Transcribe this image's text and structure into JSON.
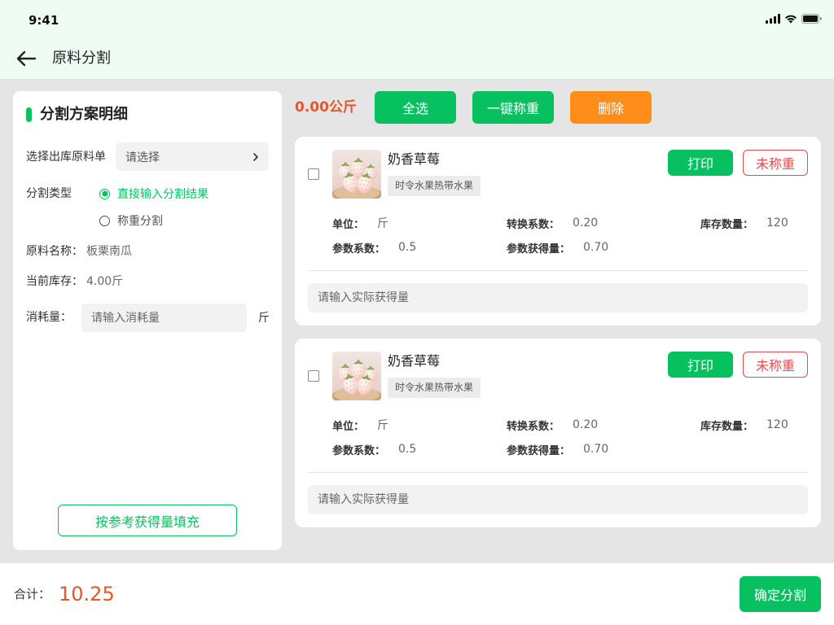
{
  "status_bar": {
    "time": "9:41",
    "icons": [
      "cellular-signal-icon",
      "wifi-icon",
      "battery-icon"
    ]
  },
  "header": {
    "title": "原料分割",
    "back_icon": "arrow-left-icon"
  },
  "left_panel": {
    "title": "分割方案明细",
    "order_select": {
      "label": "选择出库原料单",
      "placeholder": "请选择",
      "icon": "chevron-right-icon"
    },
    "split_type": {
      "label": "分割类型",
      "options": [
        {
          "label": "直接输入分割结果",
          "selected": true
        },
        {
          "label": "称重分割",
          "selected": false
        }
      ]
    },
    "material_name": {
      "label": "原料名称：",
      "value": "板栗南瓜"
    },
    "current_stock": {
      "label": "当前库存：",
      "value": "4.00斤"
    },
    "consumption": {
      "label": "消耗量：",
      "placeholder": "请输入消耗量",
      "value": "",
      "unit": "斤"
    },
    "fill_button": "按参考获得量填充"
  },
  "toolbar": {
    "total_weight": "0.00公斤",
    "select_all": "全选",
    "weigh_all": "一键称重",
    "delete": "删除"
  },
  "products": [
    {
      "name": "奶香草莓",
      "tag": "时令水果热带水果",
      "checked": false,
      "print_label": "打印",
      "status_label": "未称重",
      "fields": {
        "unit": {
          "label": "单位：",
          "value": "斤"
        },
        "conversion": {
          "label": "转换系数：",
          "value": "0.20"
        },
        "stock": {
          "label": "库存数量：",
          "value": "120"
        },
        "param_coef": {
          "label": "参数系数：",
          "value": "0.5"
        },
        "param_yield": {
          "label": "参数获得量：",
          "value": "0.70"
        }
      },
      "actual_input": {
        "placeholder": "请输入实际获得量",
        "value": ""
      }
    },
    {
      "name": "奶香草莓",
      "tag": "时令水果热带水果",
      "checked": false,
      "print_label": "打印",
      "status_label": "未称重",
      "fields": {
        "unit": {
          "label": "单位：",
          "value": "斤"
        },
        "conversion": {
          "label": "转换系数：",
          "value": "0.20"
        },
        "stock": {
          "label": "库存数量：",
          "value": "120"
        },
        "param_coef": {
          "label": "参数系数：",
          "value": "0.5"
        },
        "param_yield": {
          "label": "参数获得量：",
          "value": "0.70"
        }
      },
      "actual_input": {
        "placeholder": "请输入实际获得量",
        "value": ""
      }
    }
  ],
  "footer": {
    "total_label": "合计：",
    "total_value": "10.25",
    "confirm": "确定分割"
  },
  "colors": {
    "primary": "#07c160",
    "warning": "#ff8d1a",
    "danger": "#e84a4f",
    "accent_text": "#e4572e",
    "header_bg": "#effcf4",
    "page_bg": "#e5e5e5"
  }
}
